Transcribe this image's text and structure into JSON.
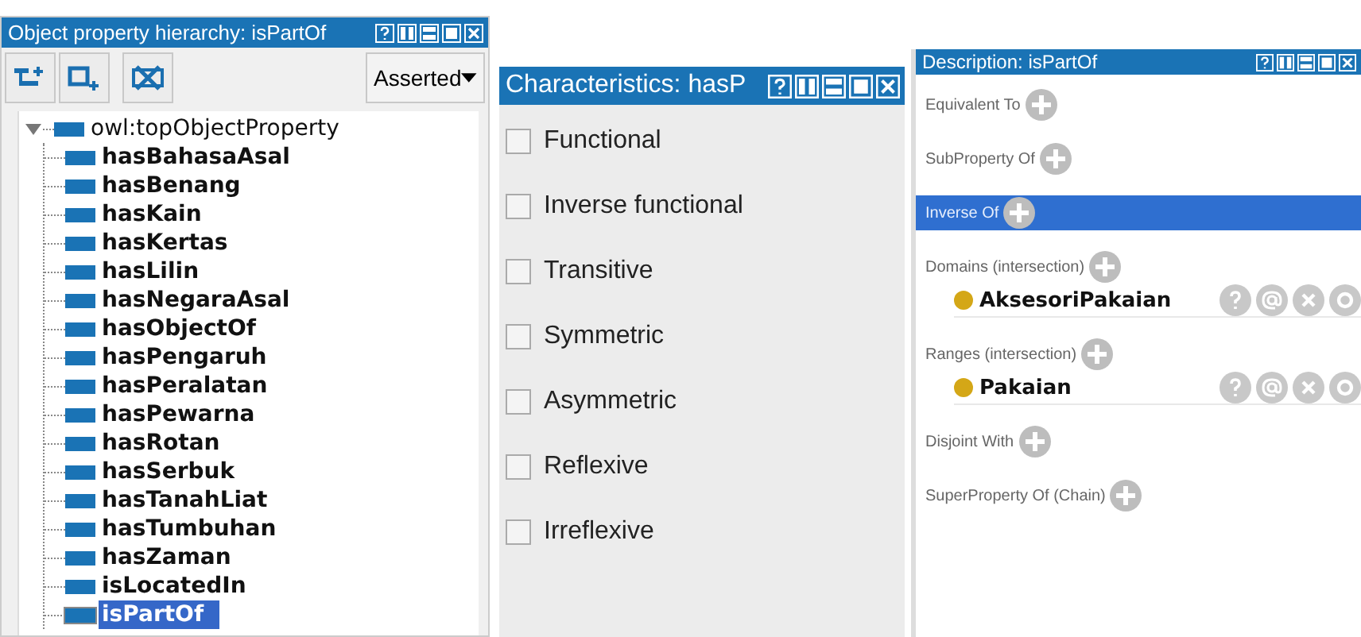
{
  "hierarchy_panel": {
    "title": "Object property hierarchy: isPartOf",
    "view_mode": "Asserted",
    "tree": [
      {
        "label": "owl:topObjectProperty",
        "expanded": true,
        "selected": false,
        "children": [
          {
            "label": "hasBahasaAsal",
            "selected": false
          },
          {
            "label": "hasBenang",
            "selected": false
          },
          {
            "label": "hasKain",
            "selected": false
          },
          {
            "label": "hasKertas",
            "selected": false
          },
          {
            "label": "hasLilin",
            "selected": false
          },
          {
            "label": "hasNegaraAsal",
            "selected": false
          },
          {
            "label": "hasObjectOf",
            "selected": false
          },
          {
            "label": "hasPengaruh",
            "selected": false
          },
          {
            "label": "hasPeralatan",
            "selected": false
          },
          {
            "label": "hasPewarna",
            "selected": false
          },
          {
            "label": "hasRotan",
            "selected": false
          },
          {
            "label": "hasSerbuk",
            "selected": false
          },
          {
            "label": "hasTanahLiat",
            "selected": false
          },
          {
            "label": "hasTumbuhan",
            "selected": false
          },
          {
            "label": "hasZaman",
            "selected": false
          },
          {
            "label": "isLocatedIn",
            "selected": false
          },
          {
            "label": "isPartOf",
            "selected": true
          }
        ]
      }
    ]
  },
  "characteristics_panel": {
    "title": "Characteristics: hasP",
    "items": [
      {
        "label": "Functional",
        "checked": false
      },
      {
        "label": "Inverse functional",
        "checked": false
      },
      {
        "label": "Transitive",
        "checked": false
      },
      {
        "label": "Symmetric",
        "checked": false
      },
      {
        "label": "Asymmetric",
        "checked": false
      },
      {
        "label": "Reflexive",
        "checked": false
      },
      {
        "label": "Irreflexive",
        "checked": false
      }
    ]
  },
  "description_panel": {
    "title": "Description: isPartOf",
    "sections": [
      {
        "label": "Equivalent To",
        "selected": false
      },
      {
        "label": "SubProperty Of",
        "selected": false
      },
      {
        "label": "Inverse Of",
        "selected": true
      },
      {
        "label": "Domains (intersection)",
        "selected": false,
        "entries": [
          {
            "label": "AksesoriPakaian"
          }
        ]
      },
      {
        "label": "Ranges (intersection)",
        "selected": false,
        "entries": [
          {
            "label": "Pakaian"
          }
        ]
      },
      {
        "label": "Disjoint With",
        "selected": false
      },
      {
        "label": "SuperProperty Of (Chain)",
        "selected": false
      }
    ]
  }
}
